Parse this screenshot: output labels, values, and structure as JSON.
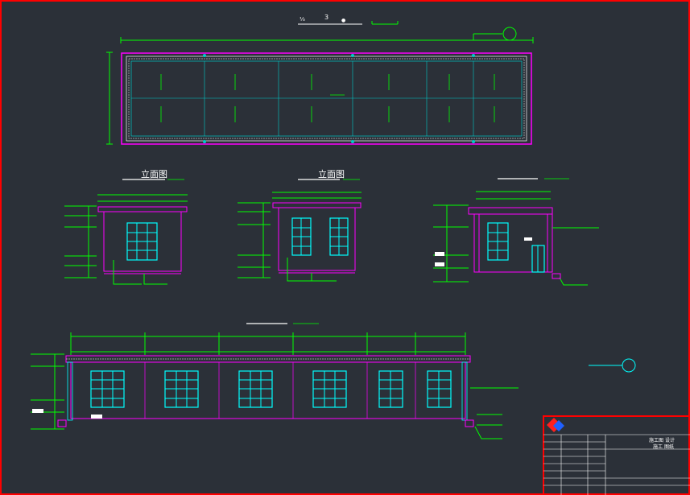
{
  "drawing": {
    "top_title_numeral": "3",
    "front_elevation_title": "立面图",
    "side_elevation_title": "立面图",
    "colors": {
      "background": "#2b3038",
      "border": "#ff0000",
      "wall": "#ff00ff",
      "dimension": "#00ff00",
      "window": "#00ffff",
      "grid": "#00c8c8",
      "text": "#ffffff"
    }
  },
  "title_block": {
    "company_line_1": "施工图 设计",
    "company_line_2": "施工 图纸",
    "logo": "diamond-logo-icon"
  }
}
